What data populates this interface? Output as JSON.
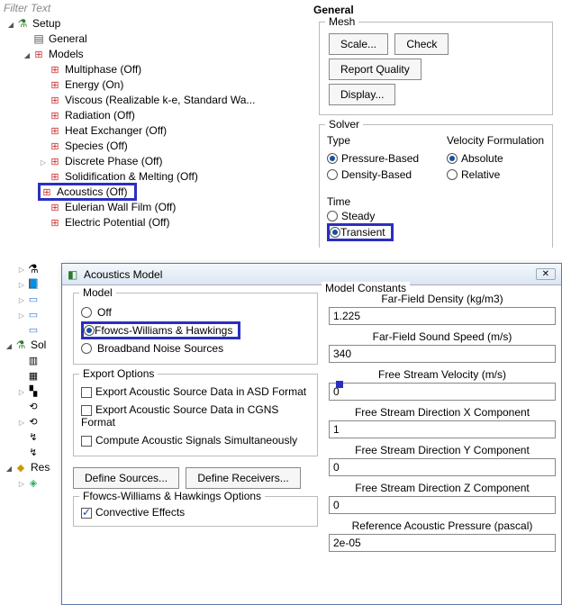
{
  "filter_text": "Filter Text",
  "tree": {
    "setup": "Setup",
    "general": "General",
    "models": "Models",
    "items": [
      "Multiphase (Off)",
      "Energy (On)",
      "Viscous (Realizable k-e, Standard Wa...",
      "Radiation (Off)",
      "Heat Exchanger (Off)",
      "Species (Off)",
      "Discrete Phase (Off)",
      "Solidification & Melting (Off)",
      "Acoustics (Off)",
      "Eulerian Wall Film (Off)",
      "Electric Potential (Off)"
    ],
    "sol": "Sol",
    "res": "Res"
  },
  "general_panel": {
    "title": "General",
    "mesh_group": "Mesh",
    "scale": "Scale...",
    "check": "Check",
    "report_quality": "Report Quality",
    "display": "Display...",
    "solver_group": "Solver",
    "type_label": "Type",
    "velocity_label": "Velocity Formulation",
    "pressure_based": "Pressure-Based",
    "density_based": "Density-Based",
    "absolute": "Absolute",
    "relative": "Relative",
    "time_label": "Time",
    "steady": "Steady",
    "transient": "Transient"
  },
  "dialog": {
    "title": "Acoustics Model",
    "model_group": "Model",
    "off": "Off",
    "fwh": "Ffowcs-Williams & Hawkings",
    "broadband": "Broadband Noise Sources",
    "export_group": "Export Options",
    "export_asd": "Export Acoustic Source Data in ASD Format",
    "export_cgns": "Export Acoustic Source Data in CGNS Format",
    "compute_simul": "Compute Acoustic Signals Simultaneously",
    "define_sources": "Define Sources...",
    "define_receivers": "Define Receivers...",
    "fwh_group": "Ffowcs-Williams & Hawkings Options",
    "convective": "Convective Effects",
    "constants_group": "Model Constants",
    "density_label": "Far-Field Density (kg/m3)",
    "density_val": "1.225",
    "sound_label": "Far-Field Sound Speed (m/s)",
    "sound_val": "340",
    "fsv_label": "Free Stream Velocity (m/s)",
    "fsv_val": "0",
    "fsdx_label": "Free Stream Direction X Component",
    "fsdx_val": "1",
    "fsdy_label": "Free Stream Direction Y Component",
    "fsdy_val": "0",
    "fsdz_label": "Free Stream Direction Z Component",
    "fsdz_val": "0",
    "ref_label": "Reference Acoustic Pressure (pascal)",
    "ref_val": "2e-05"
  }
}
